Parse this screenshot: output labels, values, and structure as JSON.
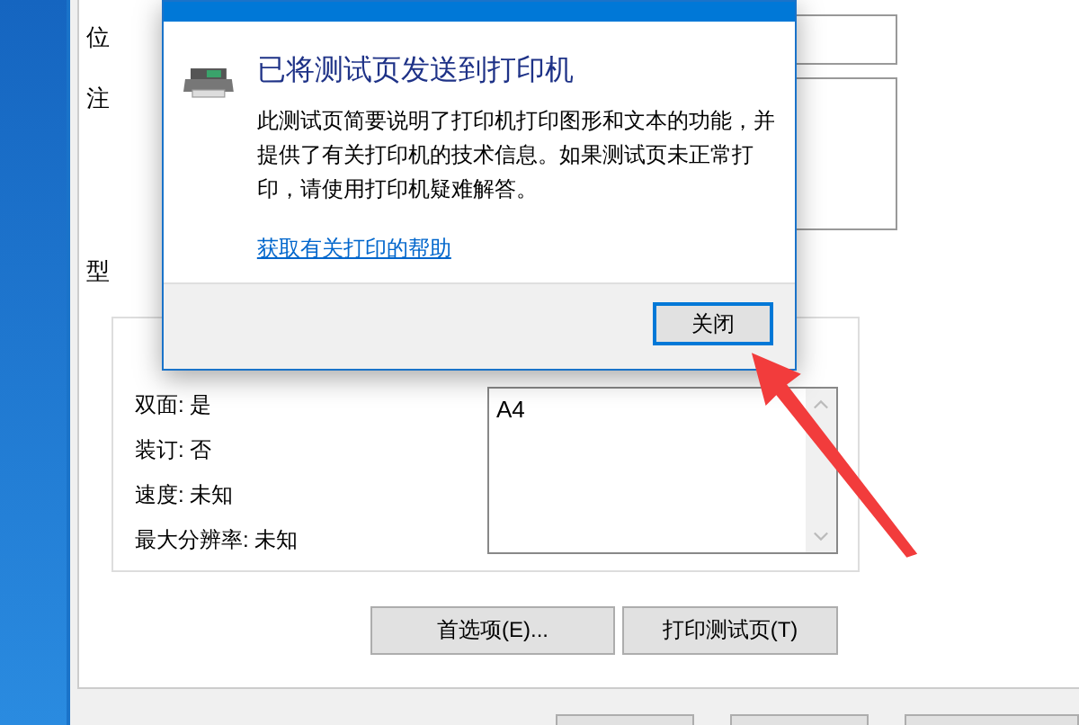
{
  "properties": {
    "labels": [
      "位",
      "注",
      "型"
    ],
    "features": [
      "双面: 是",
      "装订: 否",
      "速度: 未知",
      "最大分辨率: 未知"
    ],
    "paper_sizes": [
      "A4"
    ],
    "buttons": [
      "首选项(E)...",
      "打印测试页(T)"
    ]
  },
  "dialog": {
    "heading": "已将测试页发送到打印机",
    "message": "此测试页简要说明了打印机打印图形和文本的功能，并提供了有关打印机的技术信息。如果测试页未正常打印，请使用打印机疑难解答。",
    "help_link": "获取有关打印的帮助",
    "close_button": "关闭"
  }
}
